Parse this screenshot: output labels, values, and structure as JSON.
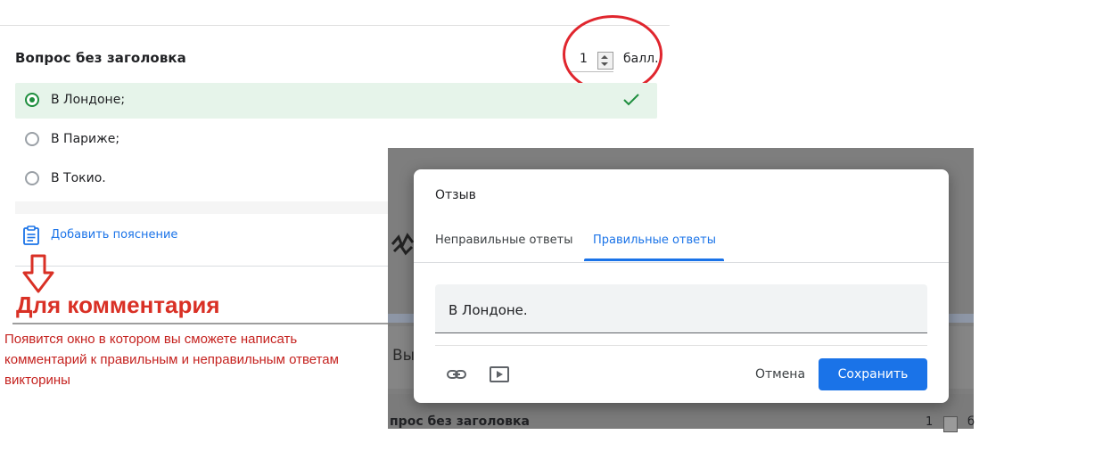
{
  "question": {
    "title": "Вопрос без заголовка",
    "points_value": "1",
    "points_unit": "балл.",
    "options": [
      {
        "label": "В Лондоне;",
        "selected": true,
        "correct": true
      },
      {
        "label": "В Париже;",
        "selected": false,
        "correct": false
      },
      {
        "label": "В Токио.",
        "selected": false,
        "correct": false
      }
    ],
    "add_explanation": "Добавить пояснение"
  },
  "annotation": {
    "heading": "Для комментария",
    "text": "Появится окно в котором вы сможете написать комментарий к правильным и неправильным ответам викторины",
    "color": "#d93025"
  },
  "background_page": {
    "partial_button": "Вы",
    "question_title": "прос без заголовка",
    "points_value": "1",
    "points_trunc": "б"
  },
  "dialog": {
    "title": "Отзыв",
    "tabs": [
      {
        "label": "Неправильные ответы",
        "active": false
      },
      {
        "label": "Правильные ответы",
        "active": true
      }
    ],
    "field_value": "В Лондоне.",
    "cancel": "Отмена",
    "save": "Сохранить",
    "accent": "#1a73e8"
  }
}
